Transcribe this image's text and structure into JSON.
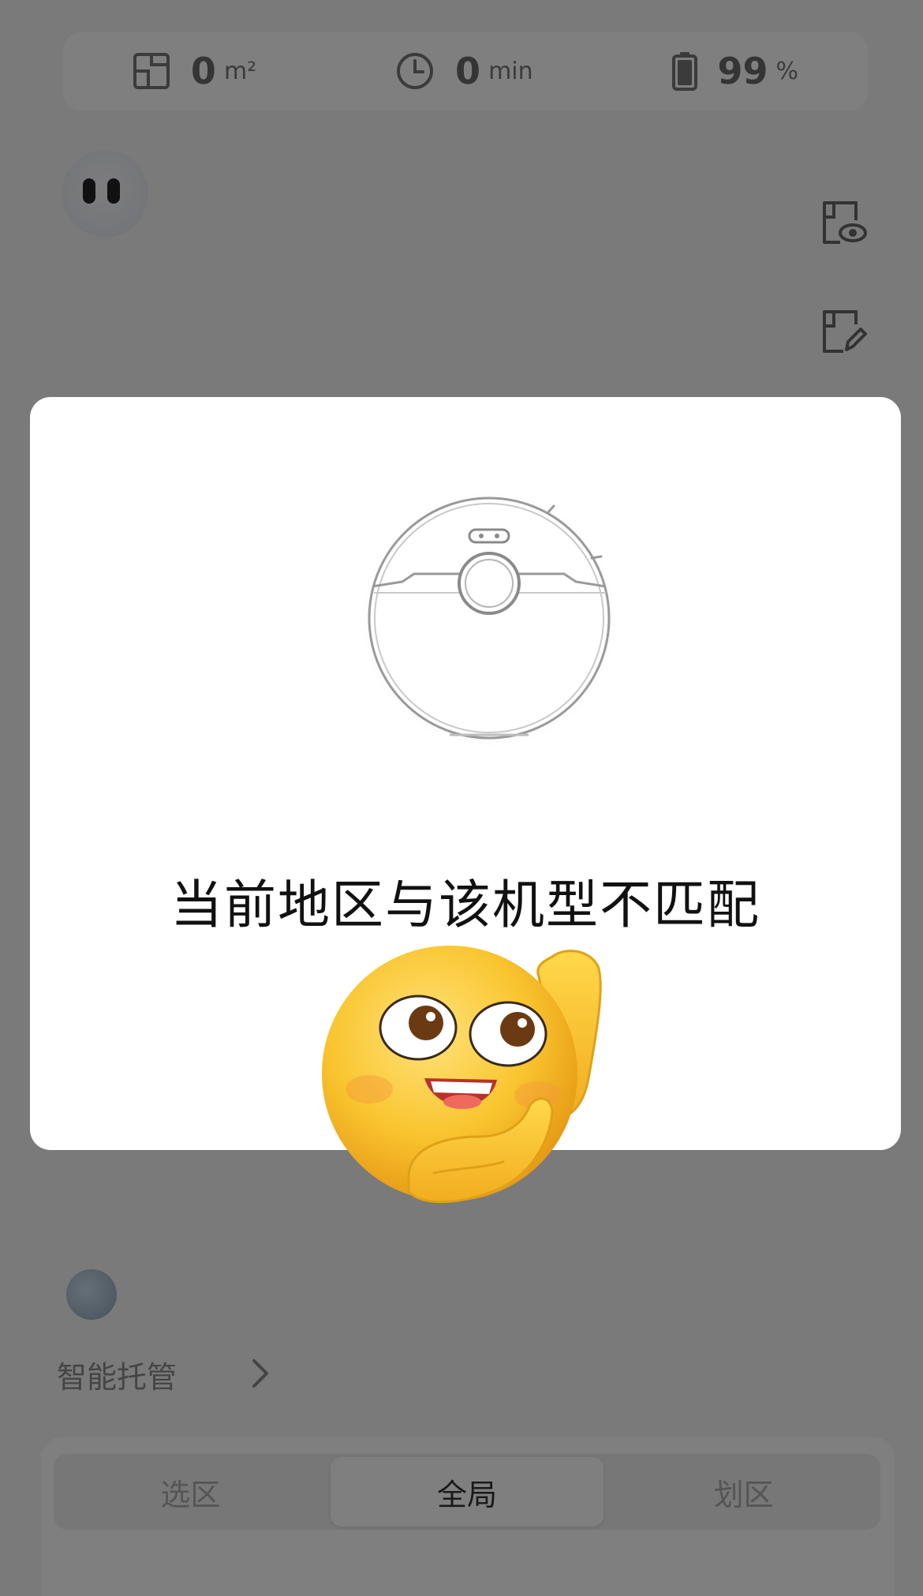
{
  "stats": {
    "area": {
      "value": "0",
      "unit": "m²",
      "icon": "floor-plan-icon"
    },
    "time": {
      "value": "0",
      "unit": "min",
      "icon": "clock-icon"
    },
    "battery": {
      "value": "99",
      "unit": "%",
      "icon": "battery-icon"
    }
  },
  "side_buttons": [
    {
      "icon": "map-view-icon"
    },
    {
      "icon": "map-edit-icon"
    }
  ],
  "agent": {
    "label": "智能托管"
  },
  "mode_tabs": {
    "items": [
      {
        "label": "选区"
      },
      {
        "label": "全局",
        "active": true
      },
      {
        "label": "划区"
      }
    ]
  },
  "dialog": {
    "message": "当前地区与该机型不匹配",
    "illustration": "robot-vacuum-outline"
  },
  "sticker": "thinking-emoji-sticker",
  "colors": {
    "overlay": "rgba(0,0,0,0.5)",
    "card": "#ffffff",
    "emoji_yellow": "#f7c431"
  }
}
